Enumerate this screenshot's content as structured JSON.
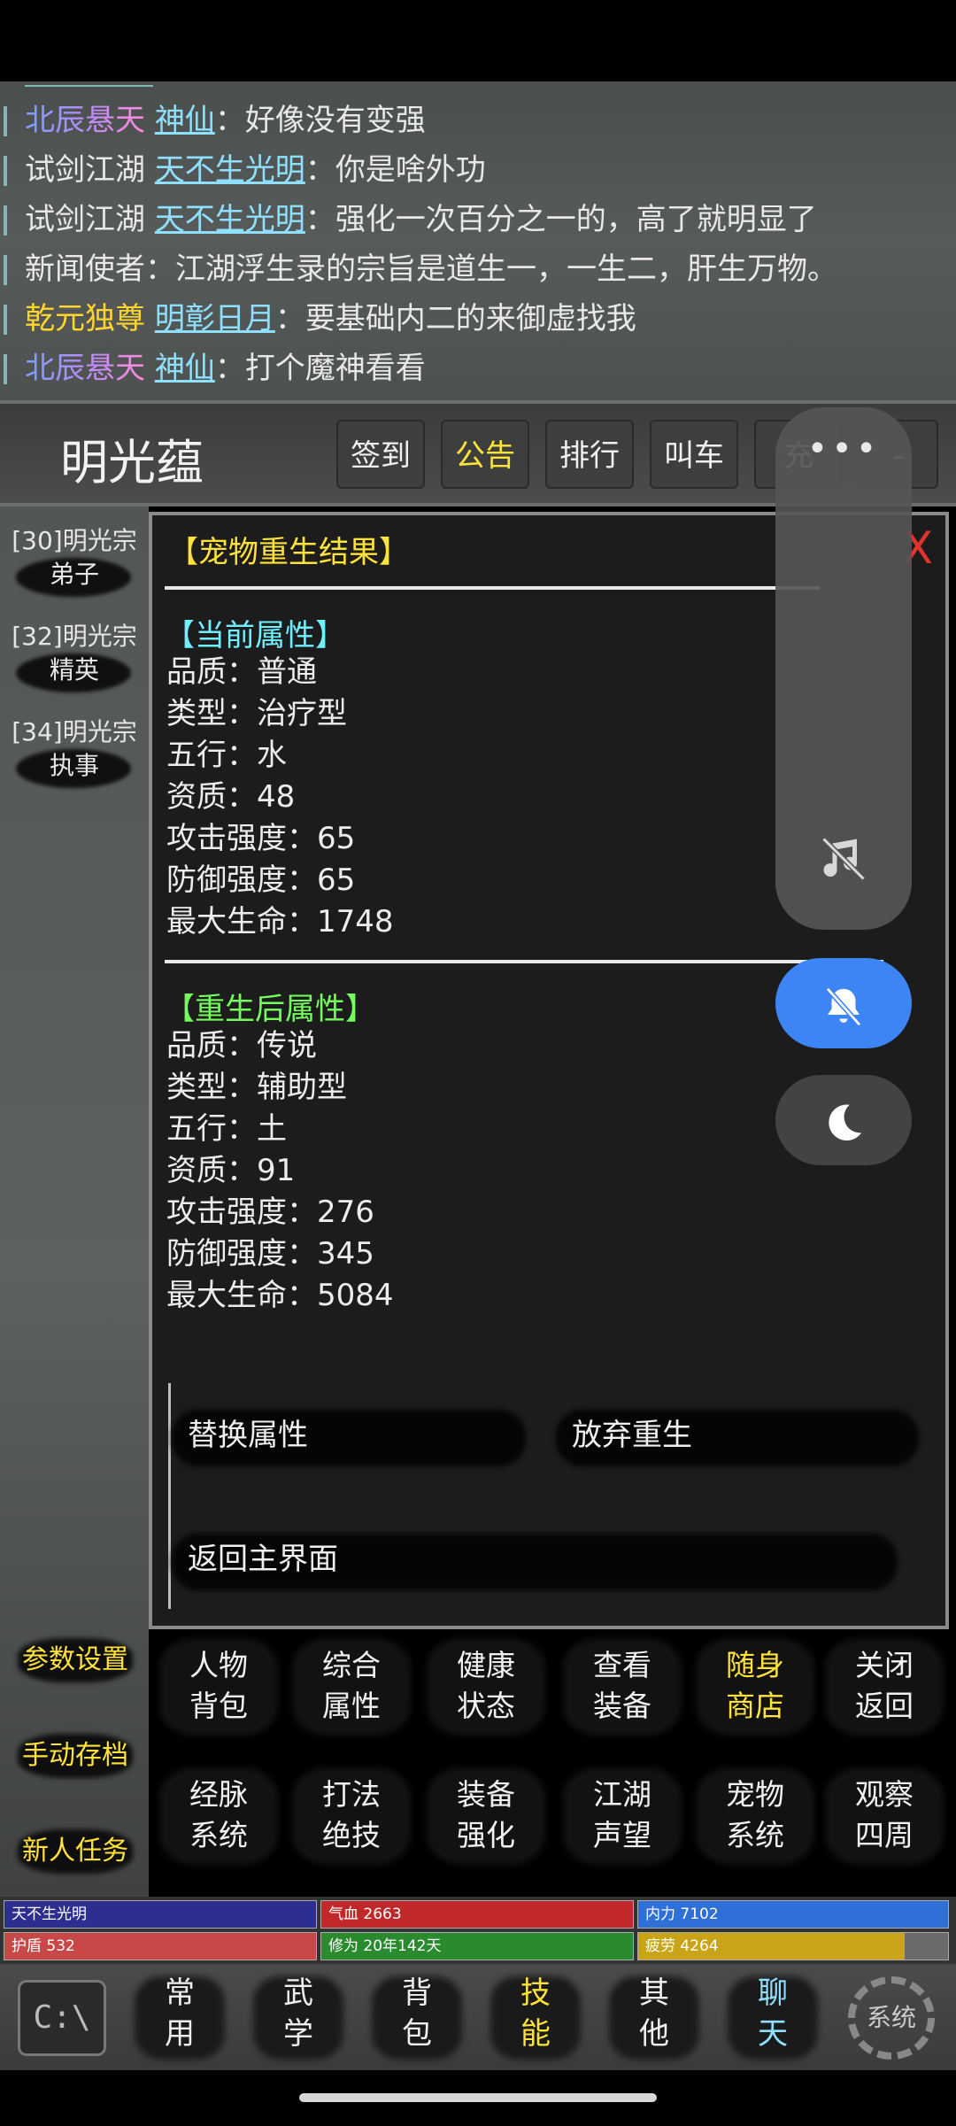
{
  "chat": {
    "lines": [
      {
        "prefix": "北辰悬天",
        "name": "神仙",
        "sep": "：",
        "msg": "好像没有变强"
      },
      {
        "prefix": "试剑江湖",
        "name": "天不生光明",
        "sep": "：",
        "msg": "你是啥外功"
      },
      {
        "prefix": "试剑江湖",
        "name": "天不生光明",
        "sep": "：",
        "msg": "强化一次百分之一的，高了就明显了"
      },
      {
        "prefix": "新闻使者",
        "name": "",
        "sep": "：",
        "msg": "江湖浮生录的宗旨是道生一，一生二，肝生万物。"
      },
      {
        "prefix": "乾元独尊",
        "name": "明彰日月",
        "sep": "：",
        "msg": "要基础内二的来御虚找我"
      },
      {
        "prefix": "北辰悬天",
        "name": "神仙",
        "sep": "：",
        "msg": "打个魔神看看"
      }
    ]
  },
  "header": {
    "player_name": "明光蕴",
    "buttons": [
      "签到",
      "公告",
      "排行",
      "叫车",
      "充",
      "-"
    ]
  },
  "left_panel": {
    "ranks": [
      {
        "line1": "[30]明光宗",
        "line2": "弟子"
      },
      {
        "line1": "[32]明光宗",
        "line2": "精英"
      },
      {
        "line1": "[34]明光宗",
        "line2": "执事"
      }
    ],
    "buttons": [
      "参数设置",
      "手动存档",
      "新人任务"
    ]
  },
  "dialog": {
    "title": "【宠物重生结果】",
    "close": "X",
    "current_title": "【当前属性】",
    "current": [
      "品质：普通",
      "类型：治疗型",
      "五行：水",
      "资质：48",
      "攻击强度：65",
      "防御强度：65",
      "最大生命：1748"
    ],
    "reborn_title": "【重生后属性】",
    "reborn": [
      "品质：传说",
      "类型：辅助型",
      "五行：土",
      "资质：91",
      "攻击强度：276",
      "防御强度：345",
      "最大生命：5084"
    ],
    "replace": "替换属性",
    "abandon": "放弃重生",
    "back": "返回主界面"
  },
  "grid": {
    "row1": [
      {
        "a": "人物",
        "b": "背包"
      },
      {
        "a": "综合",
        "b": "属性"
      },
      {
        "a": "健康",
        "b": "状态"
      },
      {
        "a": "查看",
        "b": "装备"
      },
      {
        "a": "随身",
        "b": "商店"
      },
      {
        "a": "关闭",
        "b": "返回"
      }
    ],
    "row2": [
      {
        "a": "经脉",
        "b": "系统"
      },
      {
        "a": "打法",
        "b": "绝技"
      },
      {
        "a": "装备",
        "b": "强化"
      },
      {
        "a": "江湖",
        "b": "声望"
      },
      {
        "a": "宠物",
        "b": "系统"
      },
      {
        "a": "观察",
        "b": "四周"
      }
    ]
  },
  "stats": {
    "name": "天不生光明",
    "hp": "气血 2663",
    "mp": "内力 7102",
    "shield": "护盾 532",
    "cultivation": "修为 20年142天",
    "fatigue": "疲劳 4264",
    "fatigue_level": 0.86,
    "colors": {
      "name": "#2c2f8f",
      "hp": "#c0282a",
      "mp": "#2e6fd8",
      "shield": "#c84848",
      "cultivation": "#2a8a2e",
      "fatigue": "#c9a418"
    }
  },
  "bottom_nav": {
    "cmd": "C:\\",
    "items": [
      {
        "a": "常",
        "b": "用"
      },
      {
        "a": "武",
        "b": "学"
      },
      {
        "a": "背",
        "b": "包"
      },
      {
        "a": "技",
        "b": "能"
      },
      {
        "a": "其",
        "b": "他"
      },
      {
        "a": "聊",
        "b": "天"
      }
    ],
    "system": "系统"
  },
  "overlay": {
    "more": "•••",
    "music_icon": "music-off-icon",
    "bell_icon": "bell-off-icon",
    "moon_icon": "moon-icon"
  }
}
